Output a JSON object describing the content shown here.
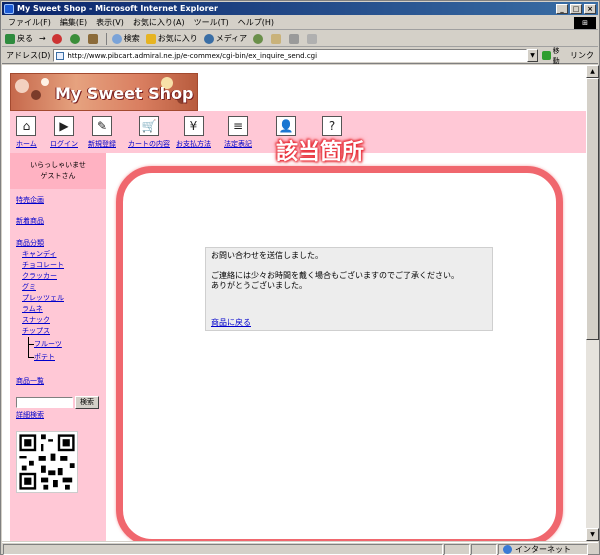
{
  "window": {
    "title": "My Sweet Shop - Microsoft Internet Explorer",
    "controls": [
      "_",
      "□",
      "×"
    ]
  },
  "menubar": [
    "ファイル(F)",
    "編集(E)",
    "表示(V)",
    "お気に入り(A)",
    "ツール(T)",
    "ヘルプ(H)"
  ],
  "toolbar": {
    "back": "戻る",
    "forward": "→",
    "search": "検索",
    "favorites": "お気に入り",
    "media": "メディア"
  },
  "address": {
    "label": "アドレス(D)",
    "url": "http://www.pibcart.admiral.ne.jp/e-commex/cgi-bin/ex_inquire_send.cgi",
    "go": "移動",
    "links": "リンク"
  },
  "status": {
    "zone": "インターネット"
  },
  "site": {
    "logo": "My Sweet Shop",
    "nav": [
      {
        "label": "ホーム",
        "icon": "home-icon",
        "glyph": "⌂"
      },
      {
        "label": "ログイン",
        "icon": "login-icon",
        "glyph": "▶"
      },
      {
        "label": "新規登録",
        "icon": "register-pen-icon",
        "glyph": "✎"
      },
      {
        "label": "カートの内容",
        "icon": "cart-icon",
        "glyph": "🛒"
      },
      {
        "label": "お支払方法",
        "icon": "payment-yen-icon",
        "glyph": "¥"
      },
      {
        "label": "法定表記",
        "icon": "legal-document-icon",
        "glyph": "≡"
      },
      {
        "label": "",
        "icon": "user-icon",
        "glyph": "👤"
      },
      {
        "label": "",
        "icon": "help-icon",
        "glyph": "?"
      }
    ],
    "welcome": [
      "いらっしゃいませ",
      "ゲストさん"
    ],
    "sidebar": {
      "special": "特売企画",
      "new_items": "新着商品",
      "category_title": "商品分類",
      "categories": [
        "キャンディ",
        "チョコレート",
        "クラッカー",
        "グミ",
        "プレッツェル",
        "ラムネ",
        "スナック",
        "チップス"
      ],
      "subcategories": [
        "フルーツ",
        "ポテト"
      ],
      "item_list": "商品一覧",
      "search_button": "検索",
      "advanced_search": "詳細検索"
    },
    "message": {
      "line1": "お問い合わせを送信しました。",
      "line2": "ご連絡には少々お時間を戴く場合もございますのでご了承ください。",
      "line3": "ありがとうございました。",
      "back_link": "商品に戻る"
    }
  },
  "annotation": {
    "label": "該当箇所",
    "color": "#f0676e"
  }
}
